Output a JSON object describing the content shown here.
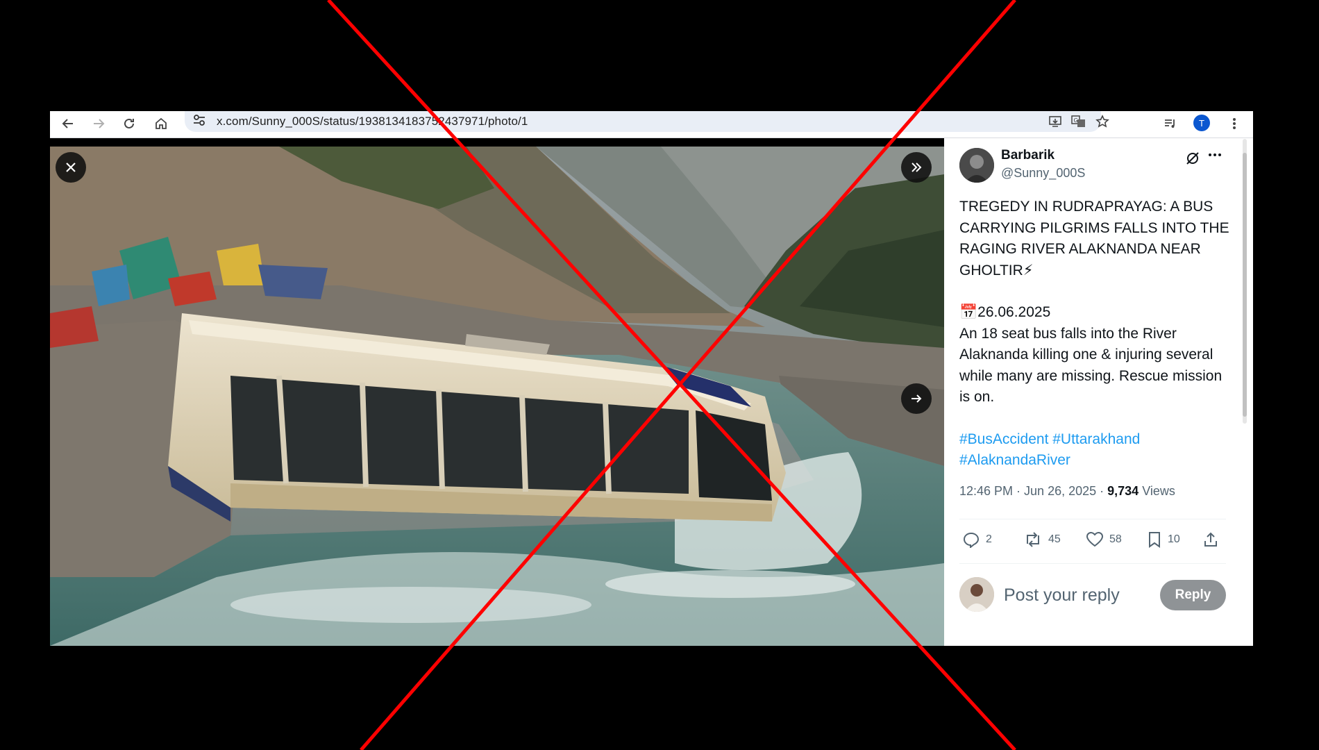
{
  "browser": {
    "url": "x.com/Sunny_000S/status/1938134183752437971/photo/1",
    "profile_initial": "T",
    "icons": [
      "back-icon",
      "forward-icon",
      "reload-icon",
      "home-icon",
      "site-settings-icon",
      "install-app-icon",
      "translate-icon",
      "bookmark-star-icon",
      "reading-list-icon",
      "profile-icon",
      "menu-kebab-icon"
    ]
  },
  "media": {
    "description_icons": [
      "close-icon",
      "expand-panel-icon",
      "next-photo-icon"
    ]
  },
  "post": {
    "author_name": "Barbarik",
    "author_handle": "@Sunny_000S",
    "text_headline": "TREGEDY IN RUDRAPRAYAG: A BUS CARRYING PILGRIMS FALLS INTO THE RAGING RIVER ALAKNANDA NEAR GHOLTIR⚡",
    "date_line": "📅26.06.2025",
    "text_body": "An 18 seat bus falls into the River Alaknanda killing one & injuring several while many are missing. Rescue mission is on.",
    "hashtags": "#BusAccident #Uttarakhand #AlaknandaRiver",
    "timestamp": "12:46 PM · Jun 26, 2025",
    "separator": " · ",
    "views_count": "9,734",
    "views_label": " Views",
    "stats": {
      "replies": "2",
      "reposts": "45",
      "likes": "58",
      "bookmarks": "10"
    }
  },
  "reply": {
    "placeholder": "Post your reply",
    "button_label": "Reply"
  },
  "overlay": {
    "type": "red-x-mark",
    "color": "#ff0000"
  },
  "colors": {
    "link": "#1d9bf0",
    "text_primary": "#0f1419",
    "text_secondary": "#536471",
    "reply_button": "#8f9396",
    "profile": "#0b57d0"
  }
}
